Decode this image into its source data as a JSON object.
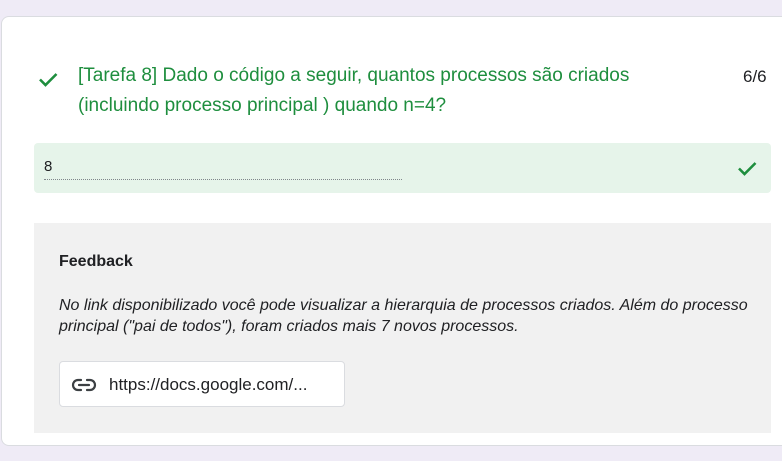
{
  "question": {
    "text": "[Tarefa 8] Dado o código a seguir, quantos processos são criados (incluindo processo principal ) quando n=4?",
    "score": "6/6",
    "status_icon": "check-icon",
    "status_color": "#1e8e3e"
  },
  "answer": {
    "value": "8",
    "status_icon": "check-icon",
    "background_color": "#e6f4ea"
  },
  "feedback": {
    "title": "Feedback",
    "text": "No link disponibilizado você pode visualizar a hierarquia de processos criados. Além do processo principal (\"pai de todos\"), foram criados mais 7 novos processos.",
    "link_label": "https://docs.google.com/...",
    "link_icon": "link-icon"
  }
}
